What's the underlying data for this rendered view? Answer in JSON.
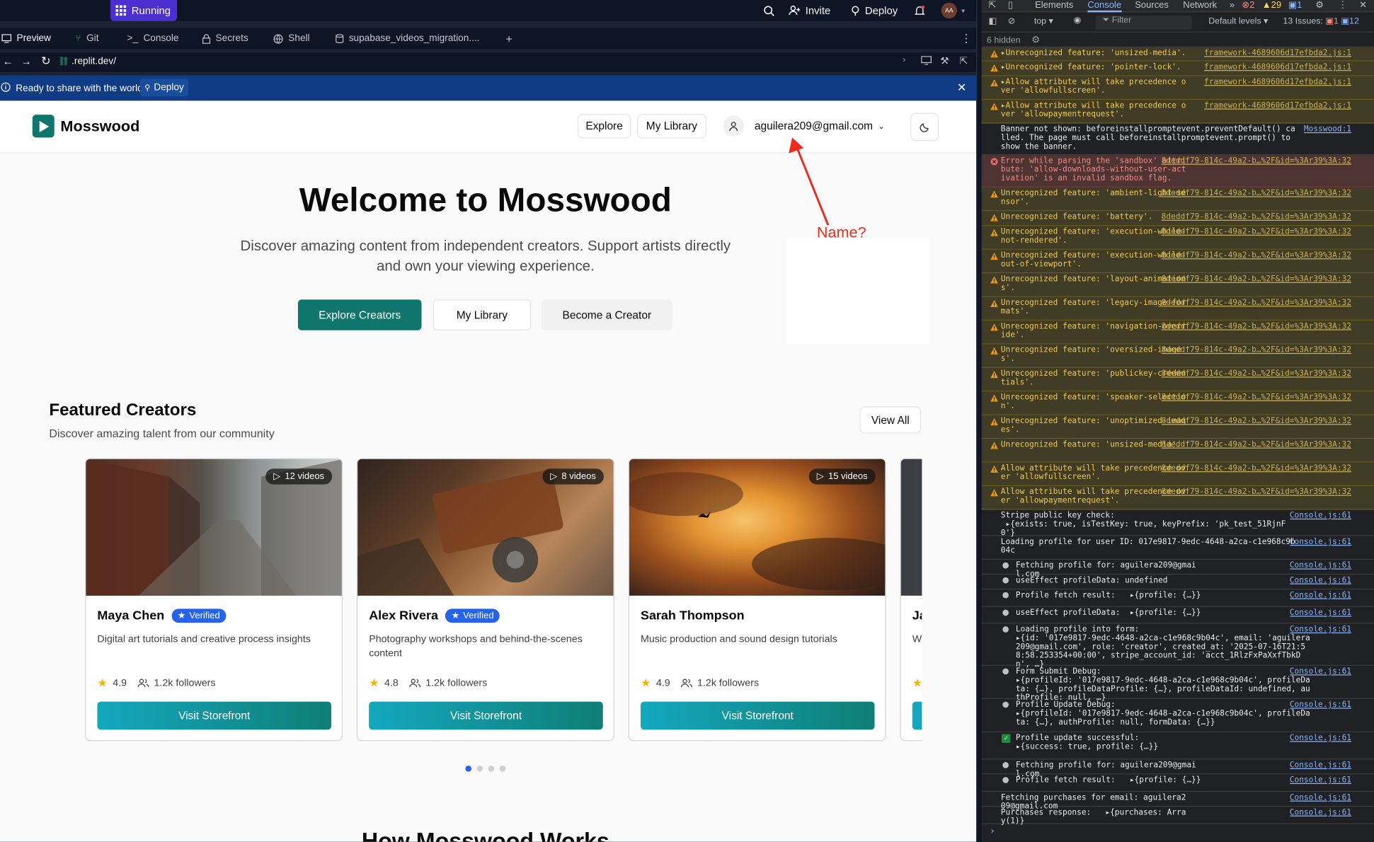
{
  "replit": {
    "running_label": "Running",
    "invite_label": "Invite",
    "deploy_label": "Deploy",
    "avatar_initials": "AA",
    "tabs": [
      "Preview",
      "Git",
      "Console",
      "Secrets",
      "Shell",
      "supabase_videos_migration...."
    ],
    "url": ".replit.dev/",
    "share_text": "Ready to share with the world?",
    "share_button": "Deploy"
  },
  "site": {
    "brand": "Mosswood",
    "nav_explore": "Explore",
    "nav_library": "My Library",
    "user_email": "aguilera209@gmail.com",
    "hero_title": "Welcome to Mosswood",
    "hero_sub_line1": "Discover amazing content from independent creators. Support artists directly",
    "hero_sub_line2": "and own your viewing experience.",
    "cta_explore": "Explore Creators",
    "cta_library": "My Library",
    "cta_become": "Become a Creator",
    "featured_title": "Featured Creators",
    "featured_sub": "Discover amazing talent from our community",
    "view_all": "View All",
    "bottom_heading": "How Mosswood Works",
    "annotation": "Name?",
    "creators": [
      {
        "name": "Maya Chen",
        "verified": "Verified",
        "videos": "12 videos",
        "desc": "Digital art tutorials and creative process insights",
        "rating": "4.9",
        "followers": "1.2k followers",
        "button": "Visit Storefront"
      },
      {
        "name": "Alex Rivera",
        "verified": "Verified",
        "videos": "8 videos",
        "desc": "Photography workshops and behind-the-scenes content",
        "rating": "4.8",
        "followers": "1.2k followers",
        "button": "Visit Storefront"
      },
      {
        "name": "Sarah Thompson",
        "verified": "",
        "videos": "15 videos",
        "desc": "Music production and sound design tutorials",
        "rating": "4.9",
        "followers": "1.2k followers",
        "button": "Visit Storefront"
      },
      {
        "name": "Ja",
        "desc": "W"
      }
    ]
  },
  "devtools": {
    "tabs": [
      "Elements",
      "Console",
      "Sources",
      "Network"
    ],
    "error_count": "2",
    "warn_count": "29",
    "info_count": "1",
    "context": "top",
    "filter_placeholder": "Filter",
    "levels": "Default levels",
    "issues_label": "13 Issues:",
    "issues_err": "1",
    "issues_info": "12",
    "hidden": "6 hidden",
    "lines": [
      {
        "kind": "warn",
        "msg": "▸Unrecognized feature: 'unsized-media'.",
        "src": "framework-4689606d17efbda2.js:1"
      },
      {
        "kind": "warn",
        "msg": "▸Unrecognized feature: 'pointer-lock'.",
        "src": "framework-4689606d17efbda2.js:1"
      },
      {
        "kind": "warn",
        "msg": "▸Allow attribute will take precedence over 'allowfullscreen'.",
        "src": "framework-4689606d17efbda2.js:1"
      },
      {
        "kind": "warn",
        "msg": "▸Allow attribute will take precedence over 'allowpaymentrequest'.",
        "src": "framework-4689606d17efbda2.js:1"
      },
      {
        "kind": "log",
        "msg": "Banner not shown: beforeinstallpromptevent.preventDefault() called. The page must call beforeinstallpromptevent.prompt() to show the banner.",
        "src": "Mosswood:1"
      },
      {
        "kind": "err",
        "msg": "Error while parsing the 'sandbox' attribute: 'allow-downloads-without-user-activation' is an invalid sandbox flag.",
        "src": "8deddf79-814c-49a2-b…%2F&id=%3Ar39%3A:32"
      },
      {
        "kind": "warn",
        "msg": "Unrecognized feature: 'ambient-light-sensor'.",
        "src": "8deddf79-814c-49a2-b…%2F&id=%3Ar39%3A:32"
      },
      {
        "kind": "warn",
        "msg": "Unrecognized feature: 'battery'.",
        "src": "8deddf79-814c-49a2-b…%2F&id=%3Ar39%3A:32"
      },
      {
        "kind": "warn",
        "msg": "Unrecognized feature: 'execution-while-not-rendered'.",
        "src": "8deddf79-814c-49a2-b…%2F&id=%3Ar39%3A:32"
      },
      {
        "kind": "warn",
        "msg": "Unrecognized feature: 'execution-while-out-of-viewport'.",
        "src": "8deddf79-814c-49a2-b…%2F&id=%3Ar39%3A:32"
      },
      {
        "kind": "warn",
        "msg": "Unrecognized feature: 'layout-animations'.",
        "src": "8deddf79-814c-49a2-b…%2F&id=%3Ar39%3A:32"
      },
      {
        "kind": "warn",
        "msg": "Unrecognized feature: 'legacy-image-formats'.",
        "src": "8deddf79-814c-49a2-b…%2F&id=%3Ar39%3A:32"
      },
      {
        "kind": "warn",
        "msg": "Unrecognized feature: 'navigation-override'.",
        "src": "8deddf79-814c-49a2-b…%2F&id=%3Ar39%3A:32"
      },
      {
        "kind": "warn",
        "msg": "Unrecognized feature: 'oversized-images'.",
        "src": "8deddf79-814c-49a2-b…%2F&id=%3Ar39%3A:32"
      },
      {
        "kind": "warn",
        "msg": "Unrecognized feature: 'publickey-credentials'.",
        "src": "8deddf79-814c-49a2-b…%2F&id=%3Ar39%3A:32"
      },
      {
        "kind": "warn",
        "msg": "Unrecognized feature: 'speaker-selection'.",
        "src": "8deddf79-814c-49a2-b…%2F&id=%3Ar39%3A:32"
      },
      {
        "kind": "warn",
        "msg": "Unrecognized feature: 'unoptimized-images'.",
        "src": "8deddf79-814c-49a2-b…%2F&id=%3Ar39%3A:32"
      },
      {
        "kind": "warn",
        "msg": "Unrecognized feature: 'unsized-media'.",
        "src": "8deddf79-814c-49a2-b…%2F&id=%3Ar39%3A:32"
      },
      {
        "kind": "warn",
        "msg": "Allow attribute will take precedence over 'allowfullscreen'.",
        "src": "8deddf79-814c-49a2-b…%2F&id=%3Ar39%3A:32"
      },
      {
        "kind": "warn",
        "msg": "Allow attribute will take precedence over 'allowpaymentrequest'.",
        "src": "8deddf79-814c-49a2-b…%2F&id=%3Ar39%3A:32"
      },
      {
        "kind": "log",
        "msg": "Stripe public key check:\n ▸{exists: true, isTestKey: true, keyPrefix: 'pk_test_51RjnF0'}",
        "src": "Console.js:61"
      },
      {
        "kind": "log",
        "msg": "Loading profile for user ID: 017e9817-9edc-4648-a2ca-c1e968c9b04c",
        "src": "Console.js:61"
      },
      {
        "kind": "dot",
        "msg": "Fetching profile for: aguilera209@gmail.com",
        "src": "Console.js:61"
      },
      {
        "kind": "dot",
        "msg": "useEffect profileData: undefined",
        "src": "Console.js:61"
      },
      {
        "kind": "dot",
        "msg": "Profile fetch result:   ▸{profile: {…}}",
        "src": "Console.js:61"
      },
      {
        "kind": "dot",
        "msg": "useEffect profileData:  ▸{profile: {…}}",
        "src": "Console.js:61"
      },
      {
        "kind": "dot",
        "msg": "Loading profile into form:\n▸{id: '017e9817-9edc-4648-a2ca-c1e968c9b04c', email: 'aguilera209@gmail.com', role: 'creator', created_at: '2025-07-16T21:58:58.253354+00:00', stripe_account_id: 'acct_1RlzFxPaXxfTbkDn', …}",
        "src": "Console.js:61"
      },
      {
        "kind": "dot",
        "msg": "Form Submit Debug:\n▸{profileId: '017e9817-9edc-4648-a2ca-c1e968c9b04c', profileData: {…}, profileDataProfile: {…}, profileDataId: undefined, authProfile: null, …}",
        "src": "Console.js:61"
      },
      {
        "kind": "dot",
        "msg": "Profile Update Debug:\n▸{profileId: '017e9817-9edc-4648-a2ca-c1e968c9b04c', profileData: {…}, authProfile: null, formData: {…}}",
        "src": "Console.js:61"
      },
      {
        "kind": "ok",
        "msg": "Profile update successful:\n▸{success: true, profile: {…}}",
        "src": "Console.js:61"
      },
      {
        "kind": "dot",
        "msg": "Fetching profile for: aguilera209@gmail.com",
        "src": "Console.js:61"
      },
      {
        "kind": "dot",
        "msg": "Profile fetch result:   ▸{profile: {…}}",
        "src": "Console.js:61"
      },
      {
        "kind": "log",
        "msg": "Fetching purchases for email: aguilera209@gmail.com",
        "src": "Console.js:61"
      },
      {
        "kind": "log",
        "msg": "Purchases response:   ▸{purchases: Array(1)}",
        "src": "Console.js:61"
      }
    ]
  },
  "colors": {
    "replit_bg": "#0e1525",
    "running": "#4b2fd1",
    "share_bar": "#0f3c85",
    "brand_teal": "#0f766e",
    "annotation_red": "#ef2b1e",
    "verified_blue": "#2563eb"
  }
}
